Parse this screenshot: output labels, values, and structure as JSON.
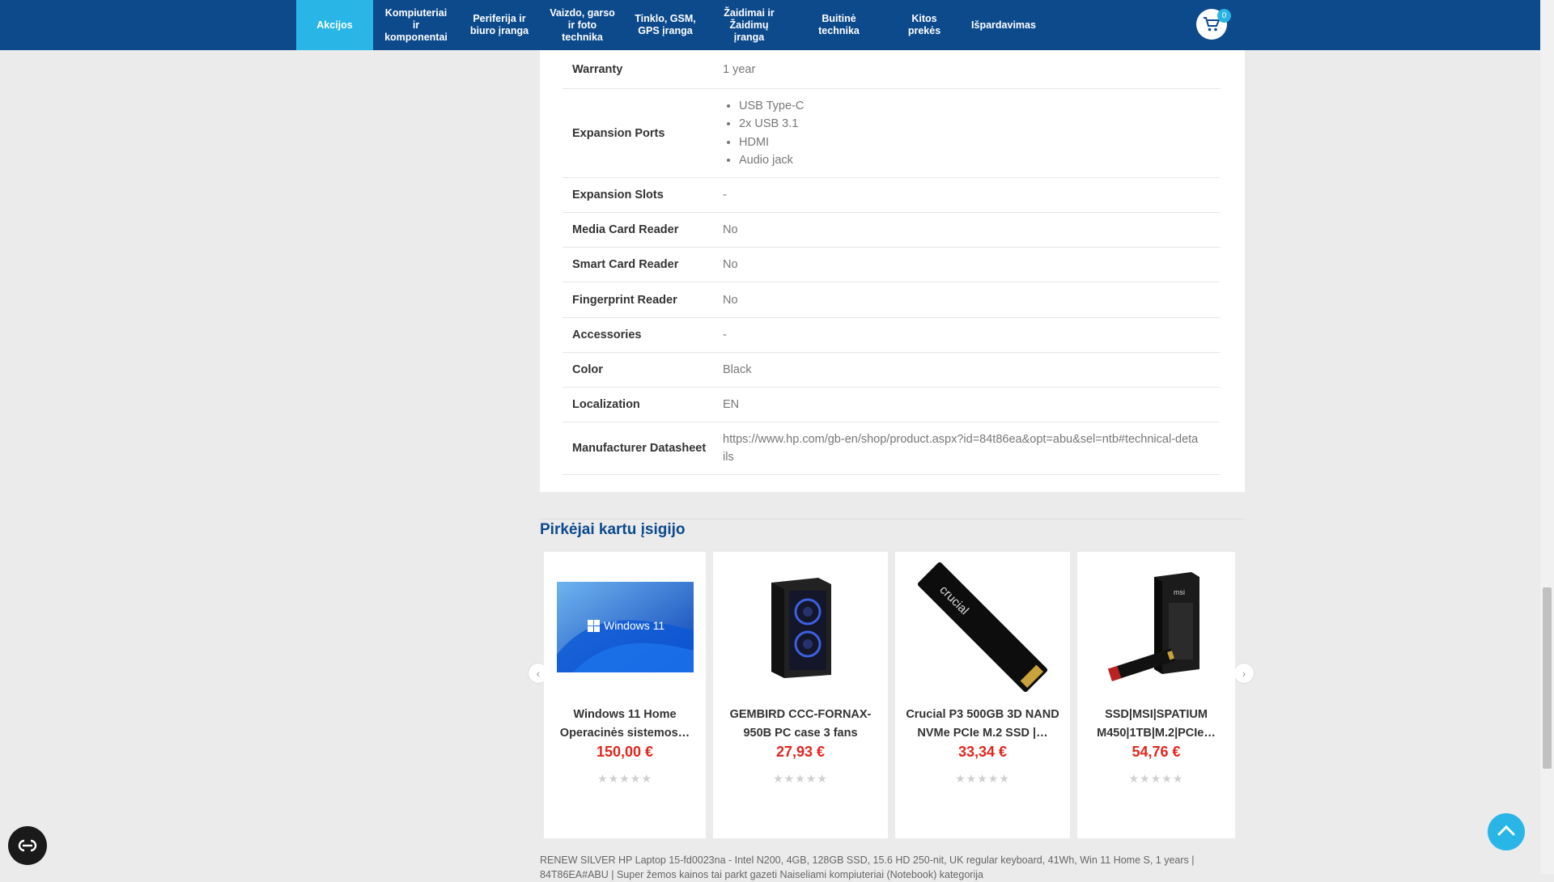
{
  "nav": {
    "items": [
      {
        "label": "Akcijos",
        "active": true
      },
      {
        "label": "Kompiuteriai ir komponentai"
      },
      {
        "label": "Periferija ir biuro įranga"
      },
      {
        "label": "Vaizdo, garso ir foto technika"
      },
      {
        "label": "Tinklo, GSM, GPS įranga"
      },
      {
        "label": "Žaidimai ir Žaidimų įranga"
      },
      {
        "label": "Buitinė technika"
      },
      {
        "label": "Kitos prekės"
      },
      {
        "label": "Išpardavimas"
      }
    ],
    "cart_count": "0"
  },
  "specs": [
    {
      "label": "Warranty",
      "value": "1 year"
    },
    {
      "label": "Expansion Ports",
      "list": [
        "USB Type-C",
        "2x USB 3.1",
        "HDMI",
        "Audio jack"
      ]
    },
    {
      "label": "Expansion Slots",
      "value": "-"
    },
    {
      "label": "Media Card Reader",
      "value": "No"
    },
    {
      "label": "Smart Card Reader",
      "value": "No"
    },
    {
      "label": "Fingerprint Reader",
      "value": "No"
    },
    {
      "label": "Accessories",
      "value": "-"
    },
    {
      "label": "Color",
      "value": "Black"
    },
    {
      "label": "Localization",
      "value": "EN"
    },
    {
      "label": "Manufacturer Datasheet",
      "value": "https://www.hp.com/gb-en/shop/product.aspx?id=84t86ea&opt=abu&sel=ntb#technical-details"
    }
  ],
  "related": {
    "title": "Pirkėjai kartu įsigijo",
    "products": [
      {
        "name": "Windows 11 Home Operacinės sistemos…",
        "price": "150,00 €",
        "image": "windows-11-image",
        "rating": 0,
        "rating_max": 5
      },
      {
        "name": "GEMBIRD CCC-FORNAX-950B PC case 3 fans",
        "price": "27,93 €",
        "image": "pc-case-image",
        "rating": 0,
        "rating_max": 5
      },
      {
        "name": "Crucial P3 500GB 3D NAND NVMe PCIe M.2 SSD |…",
        "price": "33,34 €",
        "image": "ssd-crucial-image",
        "rating": 0,
        "rating_max": 5
      },
      {
        "name": "SSD|MSI|SPATIUM M450|1TB|M.2|PCIe…",
        "price": "54,76 €",
        "image": "ssd-msi-image",
        "rating": 0,
        "rating_max": 5
      }
    ],
    "windows_logo_text": "Windows 11",
    "crucial_logo_text": "crucial",
    "msi_logo_text": "msi"
  },
  "bottom_text": "RENEW SILVER HP Laptop 15-fd0023na - Intel N200, 4GB, 128GB SSD, 15.6 HD 250-nit, UK regular keyboard, 41Wh, Win 11 Home S, 1 years | 84T86EA#ABU | Super žemos kainos tai parkt gazeti Naiseliami kompiuteriai (Notebook) kategorija",
  "colors": {
    "nav_bg": "#0c4a8c",
    "accent": "#29b6e6",
    "price": "#e1261c"
  }
}
